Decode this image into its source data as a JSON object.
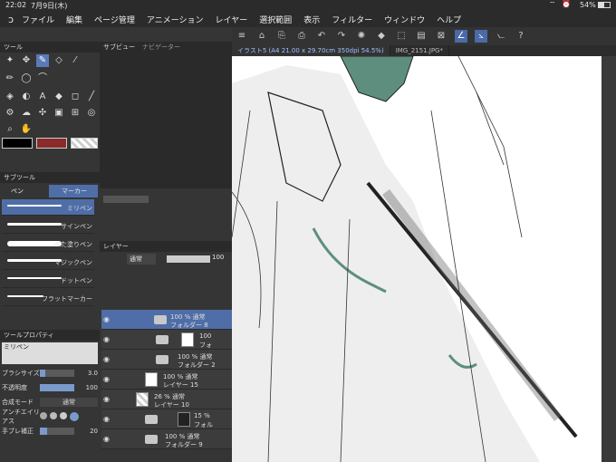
{
  "status": {
    "time": "22:02",
    "date": "7月9日(木)",
    "battery": "54%"
  },
  "menu": {
    "items": [
      "ファイル",
      "編集",
      "ページ管理",
      "アニメーション",
      "レイヤー",
      "選択範囲",
      "表示",
      "フィルター",
      "ウィンドウ",
      "ヘルプ"
    ]
  },
  "tool_panel": {
    "title": "ツール"
  },
  "subview": {
    "title": "サブビュー",
    "nav": "ナビゲーター"
  },
  "subtool": {
    "title": "サブツール",
    "tabs": [
      "ペン",
      "マーカー"
    ],
    "items": [
      "ミリペン",
      "サインペン",
      "べた塗りペン",
      "マジックペン",
      "ドットペン",
      "フラットマーカー"
    ]
  },
  "tool_property": {
    "title": "ツールプロパティ",
    "brush_name": "ミリペン",
    "rows": [
      {
        "label": "ブラシサイズ",
        "value": "3.0",
        "level": 0.15
      },
      {
        "label": "不透明度",
        "value": "100",
        "level": 1.0
      },
      {
        "label": "合成モード",
        "value": "通常"
      },
      {
        "label": "アンチエイリアス",
        "value": ""
      },
      {
        "label": "手ブレ補正",
        "value": "20",
        "level": 0.2
      }
    ]
  },
  "layer_panel": {
    "title": "レイヤー",
    "blend": "通常",
    "opacity": "100",
    "layers": [
      {
        "pct": "100 % 通常",
        "name": "フォルダー 8",
        "type": "folder"
      },
      {
        "pct": "100",
        "name": "フォ",
        "type": "folder-thumb"
      },
      {
        "pct": "100 % 通常",
        "name": "フォルダー 2",
        "type": "folder"
      },
      {
        "pct": "100 % 通常",
        "name": "レイヤー 15",
        "type": "layer"
      },
      {
        "pct": "26 % 通常",
        "name": "レイヤー 10",
        "type": "layer"
      },
      {
        "pct": "15 %",
        "name": "フォル",
        "type": "folder-thumb"
      },
      {
        "pct": "100 % 通常",
        "name": "フォルダー 9",
        "type": "folder"
      }
    ]
  },
  "doc_tabs": [
    "イラスト5 (A4 21.00 x 29.70cm 350dpi 54.5%)",
    "IMG_2151.JPG*"
  ],
  "colors": {
    "main": "#000000",
    "sub": "#8a2a2a",
    "accent": "#4a6aa8"
  }
}
